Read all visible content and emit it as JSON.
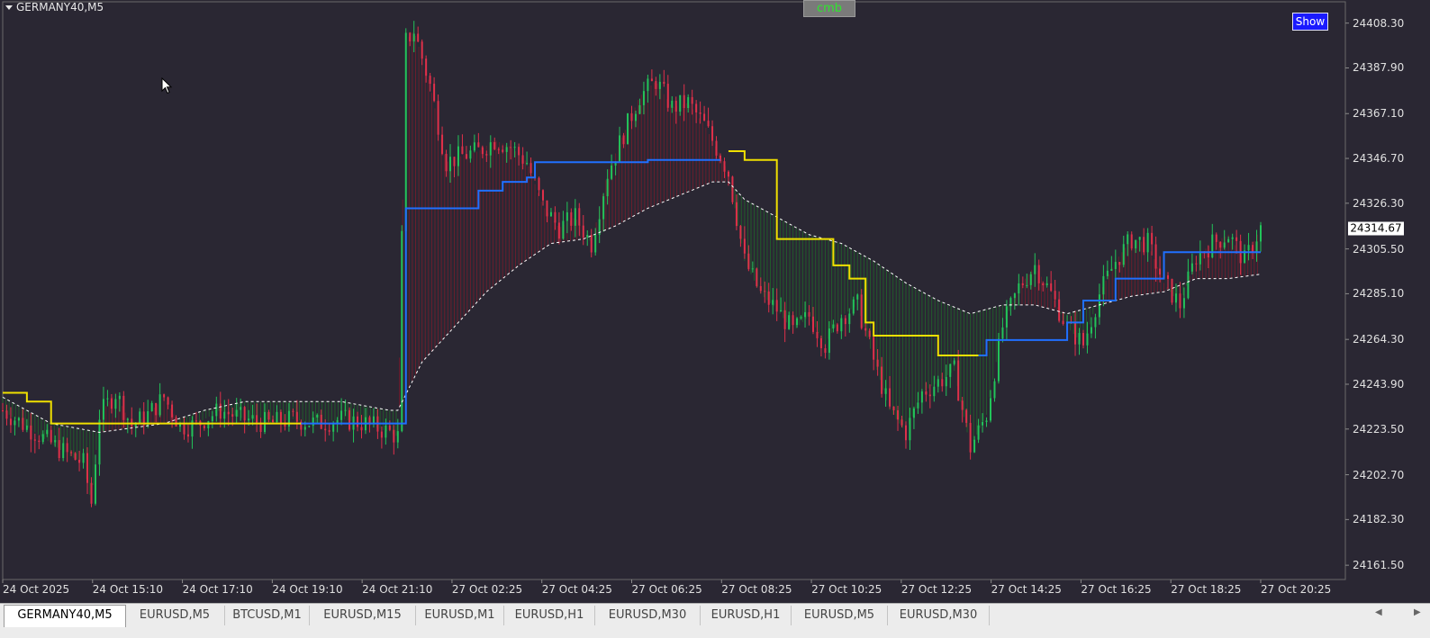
{
  "window": {
    "symbol_title": "GERMANY40,M5",
    "cmb_button": "cmb",
    "show_button": "Show"
  },
  "colors": {
    "background": "#2a2733",
    "bull_candle": "#22c45a",
    "bear_candle": "#e0304a",
    "yellow_line": "#f0e000",
    "blue_line": "#2070ff",
    "ma_dotted": "#ffffff",
    "cmb_text": "#2ee62e",
    "show_bg": "#1a1aff"
  },
  "chart_data": {
    "type": "line",
    "symbol": "GERMANY40",
    "timeframe": "M5",
    "price_axis_ticks": [
      "24408.30",
      "24387.90",
      "24367.10",
      "24346.70",
      "24326.30",
      "24305.50",
      "24285.10",
      "24264.30",
      "24243.90",
      "24223.50",
      "24202.70",
      "24182.30",
      "24161.50"
    ],
    "current_price": "24314.67",
    "ylim": [
      24155,
      24418
    ],
    "time_axis_labels": [
      "24 Oct 2025",
      "24 Oct 15:10",
      "24 Oct 17:10",
      "24 Oct 19:10",
      "24 Oct 21:10",
      "27 Oct 02:25",
      "27 Oct 04:25",
      "27 Oct 06:25",
      "27 Oct 08:25",
      "27 Oct 10:25",
      "27 Oct 12:25",
      "27 Oct 14:25",
      "27 Oct 16:25",
      "27 Oct 18:25",
      "27 Oct 20:25"
    ],
    "price_path": [
      [
        0,
        24232
      ],
      [
        4,
        24222
      ],
      [
        8,
        24212
      ],
      [
        10,
        24208
      ],
      [
        11,
        24190
      ],
      [
        12,
        24230
      ],
      [
        14,
        24240
      ],
      [
        16,
        24225
      ],
      [
        18,
        24230
      ],
      [
        20,
        24238
      ],
      [
        22,
        24225
      ],
      [
        24,
        24225
      ],
      [
        25,
        24228
      ],
      [
        27,
        24232
      ],
      [
        30,
        24228
      ],
      [
        33,
        24226
      ],
      [
        36,
        24228
      ],
      [
        39,
        24226
      ],
      [
        42,
        24228
      ],
      [
        45,
        24226
      ],
      [
        48,
        24222
      ],
      [
        49,
        24220
      ],
      [
        50,
        24400
      ],
      [
        51,
        24405
      ],
      [
        53,
        24380
      ],
      [
        55,
        24345
      ],
      [
        57,
        24348
      ],
      [
        59,
        24350
      ],
      [
        61,
        24355
      ],
      [
        63,
        24352
      ],
      [
        65,
        24345
      ],
      [
        67,
        24325
      ],
      [
        69,
        24315
      ],
      [
        71,
        24320
      ],
      [
        73,
        24308
      ],
      [
        75,
        24340
      ],
      [
        77,
        24358
      ],
      [
        79,
        24375
      ],
      [
        81,
        24382
      ],
      [
        83,
        24370
      ],
      [
        85,
        24372
      ],
      [
        87,
        24362
      ],
      [
        89,
        24348
      ],
      [
        90,
        24340
      ],
      [
        92,
        24300
      ],
      [
        94,
        24285
      ],
      [
        96,
        24278
      ],
      [
        98,
        24268
      ],
      [
        100,
        24275
      ],
      [
        102,
        24262
      ],
      [
        104,
        24275
      ],
      [
        106,
        24280
      ],
      [
        108,
        24255
      ],
      [
        110,
        24232
      ],
      [
        112,
        24222
      ],
      [
        114,
        24240
      ],
      [
        116,
        24245
      ],
      [
        118,
        24250
      ],
      [
        120,
        24215
      ],
      [
        122,
        24230
      ],
      [
        124,
        24270
      ],
      [
        126,
        24288
      ],
      [
        128,
        24298
      ],
      [
        130,
        24285
      ],
      [
        132,
        24270
      ],
      [
        134,
        24262
      ],
      [
        136,
        24285
      ],
      [
        138,
        24300
      ],
      [
        140,
        24310
      ],
      [
        142,
        24308
      ],
      [
        144,
        24290
      ],
      [
        146,
        24280
      ],
      [
        148,
        24302
      ],
      [
        150,
        24308
      ],
      [
        152,
        24312
      ],
      [
        154,
        24300
      ],
      [
        156,
        24315
      ]
    ],
    "yellow_level_line": [
      [
        0,
        24240
      ],
      [
        3,
        24236
      ],
      [
        6,
        24226
      ],
      [
        10,
        24226
      ],
      [
        20,
        24226
      ],
      [
        30,
        24226
      ],
      [
        36,
        24226
      ],
      [
        37,
        24226
      ],
      [
        90,
        24350
      ],
      [
        92,
        24346
      ],
      [
        95,
        24346
      ],
      [
        96,
        24310
      ],
      [
        102,
        24310
      ],
      [
        103,
        24298
      ],
      [
        105,
        24292
      ],
      [
        107,
        24272
      ],
      [
        108,
        24266
      ],
      [
        115,
        24266
      ],
      [
        116,
        24257
      ],
      [
        121,
        24257
      ]
    ],
    "blue_level_line": [
      [
        37,
        24226
      ],
      [
        49,
        24226
      ],
      [
        50,
        24324
      ],
      [
        58,
        24324
      ],
      [
        59,
        24332
      ],
      [
        62,
        24336
      ],
      [
        65,
        24338
      ],
      [
        66,
        24345
      ],
      [
        75,
        24345
      ],
      [
        80,
        24346
      ],
      [
        89,
        24346
      ],
      [
        121,
        24257
      ],
      [
        122,
        24264
      ],
      [
        130,
        24264
      ],
      [
        132,
        24272
      ],
      [
        134,
        24282
      ],
      [
        138,
        24292
      ],
      [
        142,
        24292
      ],
      [
        144,
        24304
      ],
      [
        156,
        24304
      ]
    ],
    "dotted_ma_line": [
      [
        0,
        24238
      ],
      [
        6,
        24226
      ],
      [
        12,
        24222
      ],
      [
        20,
        24226
      ],
      [
        25,
        24232
      ],
      [
        30,
        24236
      ],
      [
        36,
        24236
      ],
      [
        42,
        24236
      ],
      [
        48,
        24232
      ],
      [
        49,
        24232
      ],
      [
        52,
        24254
      ],
      [
        56,
        24270
      ],
      [
        60,
        24286
      ],
      [
        64,
        24298
      ],
      [
        68,
        24308
      ],
      [
        72,
        24310
      ],
      [
        76,
        24316
      ],
      [
        80,
        24324
      ],
      [
        84,
        24330
      ],
      [
        88,
        24336
      ],
      [
        90,
        24336
      ],
      [
        92,
        24328
      ],
      [
        96,
        24320
      ],
      [
        100,
        24312
      ],
      [
        104,
        24308
      ],
      [
        108,
        24300
      ],
      [
        112,
        24290
      ],
      [
        116,
        24282
      ],
      [
        120,
        24276
      ],
      [
        124,
        24280
      ],
      [
        128,
        24280
      ],
      [
        132,
        24276
      ],
      [
        136,
        24280
      ],
      [
        140,
        24284
      ],
      [
        144,
        24286
      ],
      [
        148,
        24292
      ],
      [
        152,
        24292
      ],
      [
        156,
        24294
      ]
    ],
    "grid": false
  },
  "tabs": [
    "GERMANY40,M5",
    "EURUSD,M5",
    "BTCUSD,M1",
    "EURUSD,M15",
    "EURUSD,M1",
    "EURUSD,H1",
    "EURUSD,M30",
    "EURUSD,H1",
    "EURUSD,M5",
    "EURUSD,M30"
  ],
  "active_tab_index": 0
}
